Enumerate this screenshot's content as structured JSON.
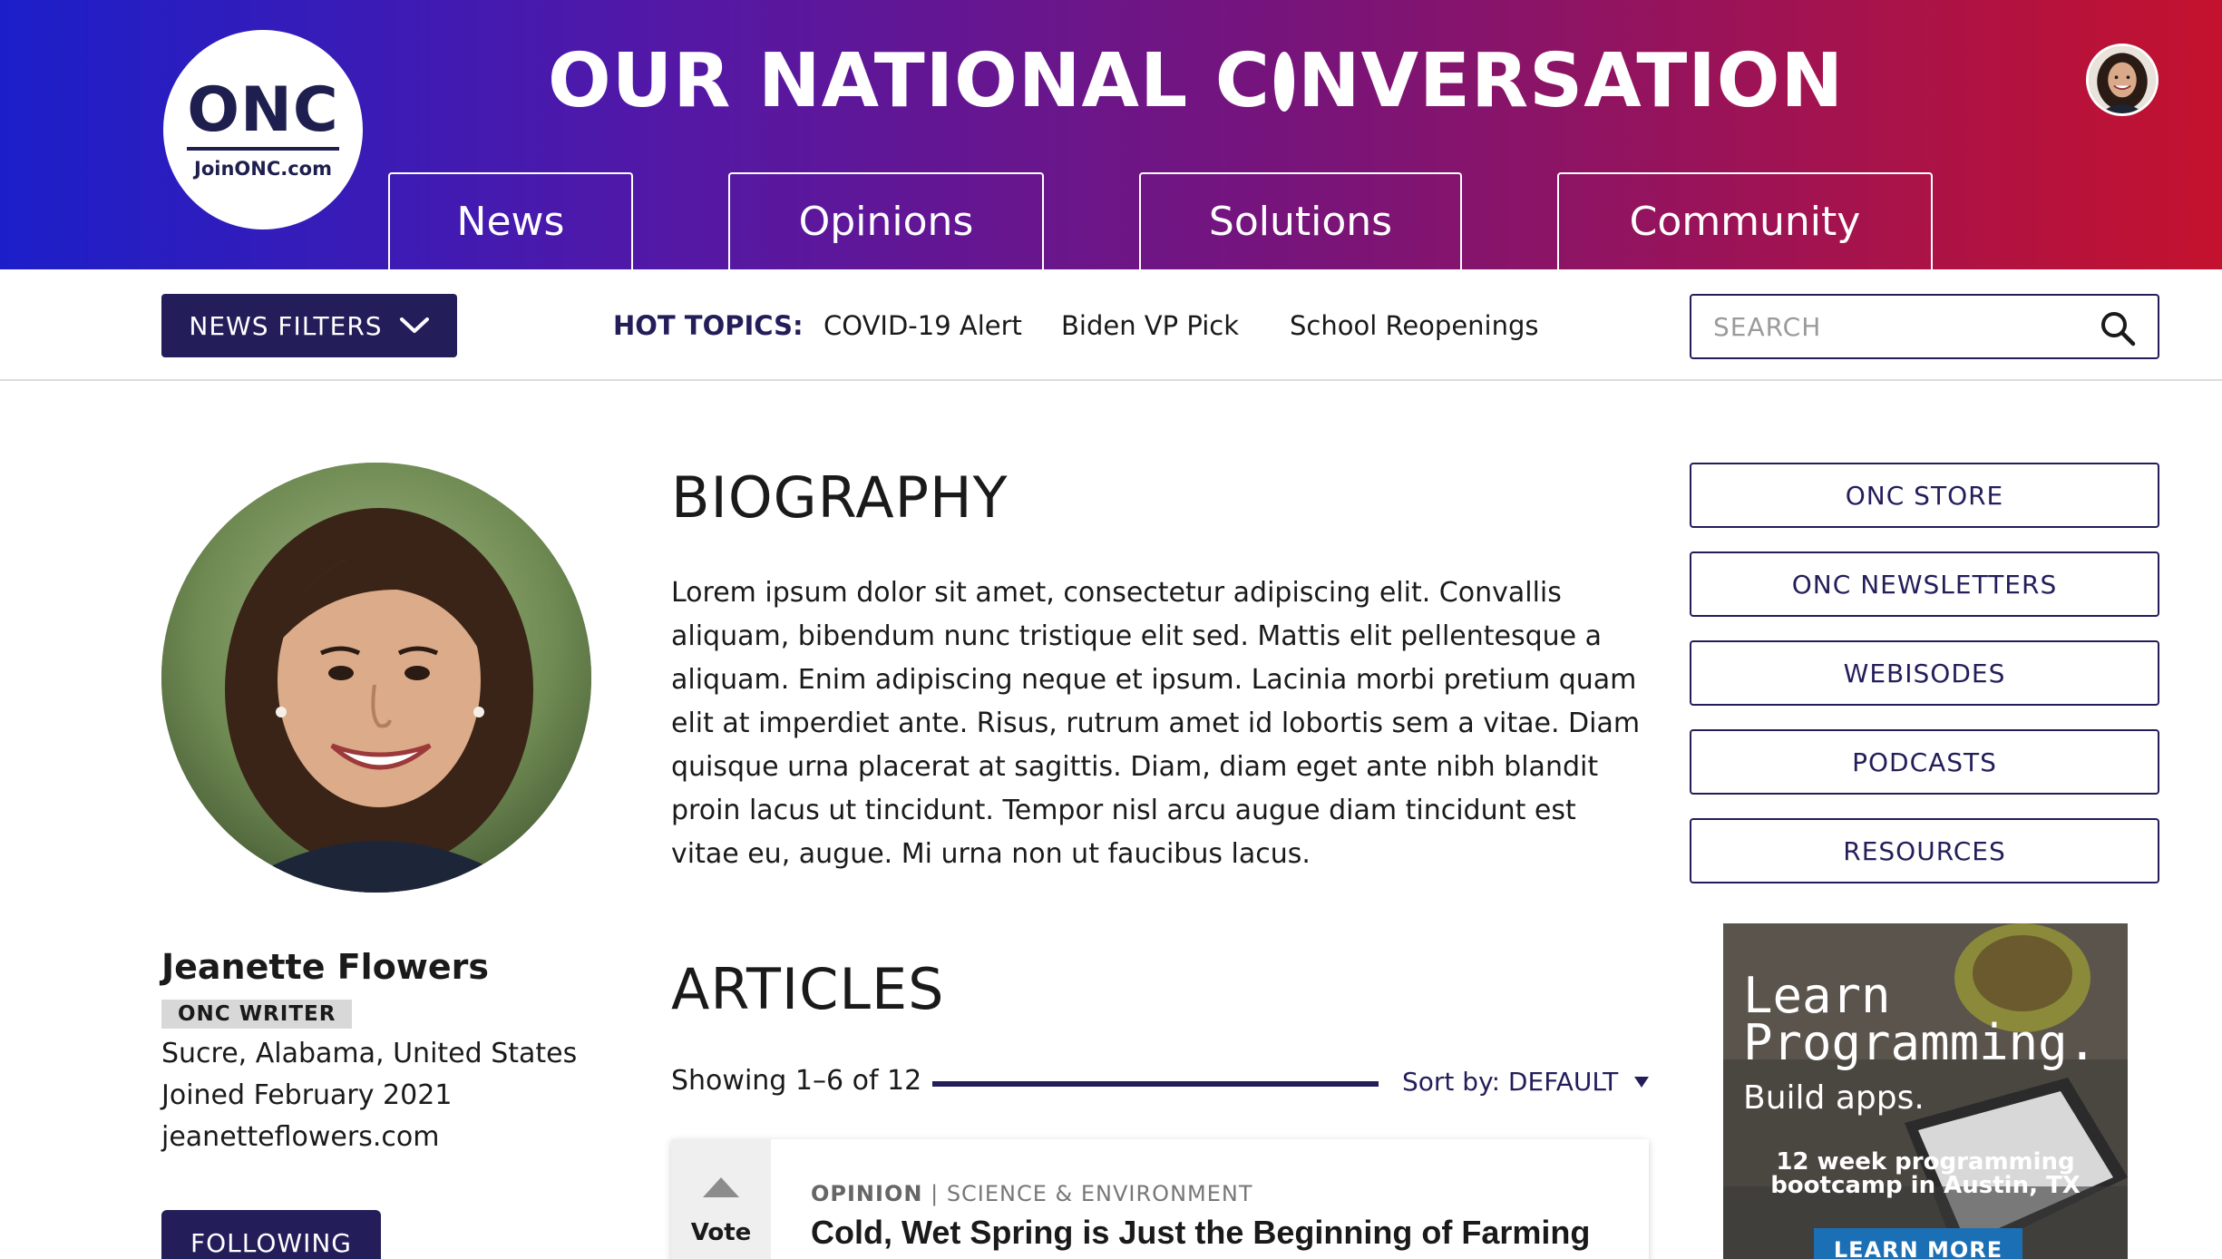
{
  "header": {
    "logo_text": "ONC",
    "logo_url": "JoinONC.com",
    "title_part1": "OUR NATIONAL C",
    "title_part2": "NVERSATION",
    "nav": [
      {
        "label": "News"
      },
      {
        "label": "Opinions"
      },
      {
        "label": "Solutions"
      },
      {
        "label": "Community"
      }
    ]
  },
  "filter_bar": {
    "news_filters_label": "NEWS FILTERS",
    "hot_topics_label": "HOT TOPICS:",
    "hot_topics": [
      "COVID-19 Alert",
      "Biden VP Pick",
      "School Reopenings"
    ],
    "search_placeholder": "SEARCH"
  },
  "profile": {
    "name": "Jeanette Flowers",
    "role": "ONC WRITER",
    "location": "Sucre, Alabama, United States",
    "joined": "Joined February 2021",
    "website": "jeanetteflowers.com",
    "follow_label": "FOLLOWING"
  },
  "biography": {
    "heading": "BIOGRAPHY",
    "text": "Lorem ipsum dolor sit amet, consectetur adipiscing elit. Convallis aliquam, bibendum nunc tristique elit sed. Mattis elit pellentesque a aliquam. Enim adipiscing neque et ipsum. Lacinia morbi pretium quam elit at imperdiet ante. Risus, rutrum amet id lobortis sem a vitae. Diam quisque urna placerat at sagittis. Diam, diam eget ante nibh blandit proin lacus ut tincidunt. Tempor nisl arcu augue diam tincidunt est vitae eu, augue. Mi urna non ut faucibus lacus."
  },
  "articles": {
    "heading": "ARTICLES",
    "showing": "Showing 1–6 of 12",
    "sort_label": "Sort by: DEFAULT",
    "items": [
      {
        "vote_label": "Vote",
        "type": "OPINION",
        "separator": "|",
        "category": "SCIENCE & ENVIRONMENT",
        "title": "Cold, Wet Spring is Just the Beginning of Farming"
      }
    ]
  },
  "sidebar": {
    "links": [
      {
        "label": "ONC STORE"
      },
      {
        "label": "ONC NEWSLETTERS"
      },
      {
        "label": "WEBISODES"
      },
      {
        "label": "PODCASTS"
      },
      {
        "label": "RESOURCES"
      }
    ],
    "ad": {
      "title_line1": "Learn",
      "title_line2": "Programming.",
      "subtitle": "Build apps.",
      "small_line1": "12 week programming",
      "small_line2": "bootcamp in Austin, TX",
      "button": "LEARN MORE"
    }
  },
  "colors": {
    "navy": "#231e5a",
    "gradient_start": "#1c1fc9",
    "gradient_end": "#c4122e",
    "ad_button": "#1b6fb5"
  }
}
